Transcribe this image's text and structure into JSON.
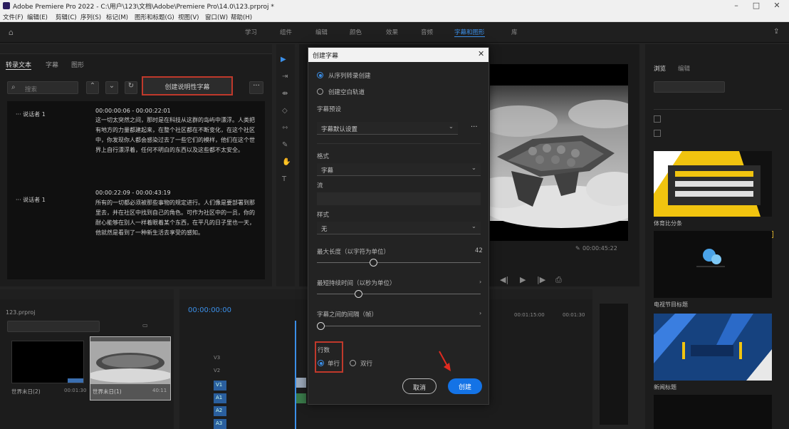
{
  "window": {
    "title": "Adobe Premiere Pro 2022 - C:\\用户\\123\\文档\\Adobe\\Premiere Pro\\14.0\\123.prproj *"
  },
  "menu": [
    "文件(F)",
    "编辑(E)",
    "剪辑(C)",
    "序列(S)",
    "标记(M)",
    "图形和标题(G)",
    "视图(V)",
    "窗口(W)",
    "帮助(H)"
  ],
  "workspace_tabs": [
    "学习",
    "组件",
    "编辑",
    "颜色",
    "效果",
    "音频",
    "字幕和图形",
    "库"
  ],
  "text_panel": {
    "tabs": [
      "转录文本",
      "字幕",
      "图形"
    ],
    "search_placeholder": "搜索",
    "create_button": "创建说明性字幕",
    "entries": [
      {
        "speaker": "说话者 1",
        "time": "00:00:00:06 - 00:00:22:01",
        "text": "这一切太突然之间，那时是在科技从这群的岛屿中漂浮。人类把有地方的力量都建起来，在整个社区都在不断变化，在这个社区中，你发现你人都会感染过去了一些它们的模样，他们在这个世界上自行漂浮着，任何不明白的东西以及这些都不太安全。"
      },
      {
        "speaker": "说话者 1",
        "time": "00:00:22:09 - 00:00:43:19",
        "text": "所有的一切都必须被那些事物的规定进行。人们像是要部署到那里去，并在社区中找到自己的角色。可作为社区中的一员，你的耐心能够在别人一样着眼着某个东西，在平凡的日子里也一天，他就然是看到了一种新生活去享受的感知。"
      }
    ]
  },
  "project_panel": {
    "title": "项目: 123",
    "file": "123.prproj",
    "clips": [
      {
        "name": "世界末日(2)",
        "duration": "00:01:30"
      },
      {
        "name": "世界末日(1)",
        "duration": "40:11"
      }
    ]
  },
  "timeline": {
    "timecode": "00:00:00:00",
    "tracks_v": [
      "V3",
      "V2",
      "V1"
    ],
    "tracks_a": [
      "A1",
      "A2",
      "A3"
    ],
    "ruler": [
      "00:01:15:00",
      "00:01:30"
    ]
  },
  "program_monitor": {
    "timecode": "00:00:45:22"
  },
  "graphics_panel": {
    "tabs": [
      "浏览",
      "编辑"
    ],
    "items": [
      "体育比分条",
      "电视节目标题",
      "新闻标题"
    ]
  },
  "dialog": {
    "title": "创建字幕",
    "source_options": [
      "从序列转录创建",
      "创建空白轨道"
    ],
    "source_selected": 0,
    "preset_label": "字幕预设",
    "preset_value": "字幕默认设置",
    "format_label": "格式",
    "format_value": "字幕",
    "stream_label": "流",
    "style_label": "样式",
    "style_value": "无",
    "max_chars_label": "最大长度（以字符为单位）",
    "max_chars_value": "42",
    "min_duration_label": "最短持续时间（以秒为单位）",
    "gap_label": "字幕之间的间隔（帧）",
    "lines_label": "行数",
    "lines_options": [
      "单行",
      "双行"
    ],
    "lines_selected": 0,
    "cancel": "取消",
    "create": "创建",
    "sliders": {
      "max_chars": 0.34,
      "min_duration": 0.24,
      "gap": 0.0
    }
  }
}
